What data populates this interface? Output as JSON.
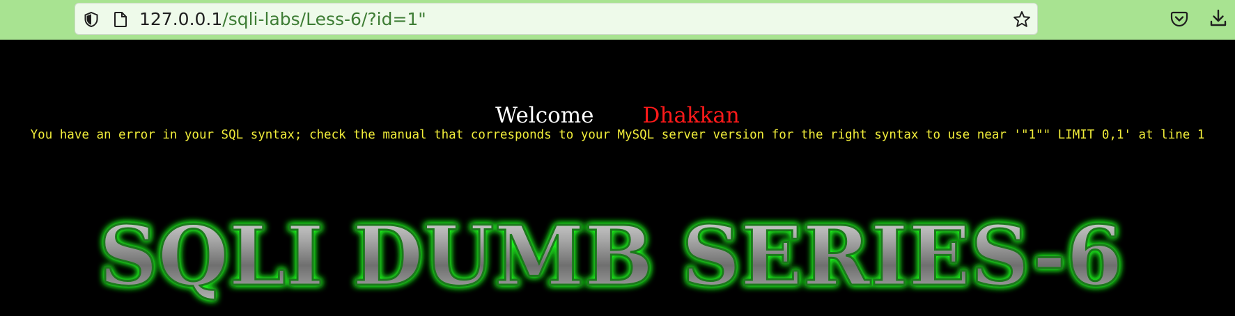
{
  "browser": {
    "url_host": "127.0.0.1",
    "url_path": "/sqli-labs/Less-6/?id=1\"",
    "icons": [
      "shield-icon",
      "page-icon",
      "star-icon",
      "pocket-icon",
      "download-icon"
    ]
  },
  "page": {
    "welcome": "Welcome",
    "username": "Dhakkan",
    "error_message": "You have an error in your SQL syntax; check the manual that corresponds to your MySQL server version for the right syntax to use near '\"1\"\" LIMIT 0,1' at line 1",
    "banner_text": "SQLI DUMB SERIES-6"
  },
  "colors": {
    "toolbar_bg": "#a8e391",
    "url_path": "#3e7d35",
    "error_text": "#f2ee3a",
    "username": "#ff1a1a",
    "banner_glow": "#22ff22"
  }
}
